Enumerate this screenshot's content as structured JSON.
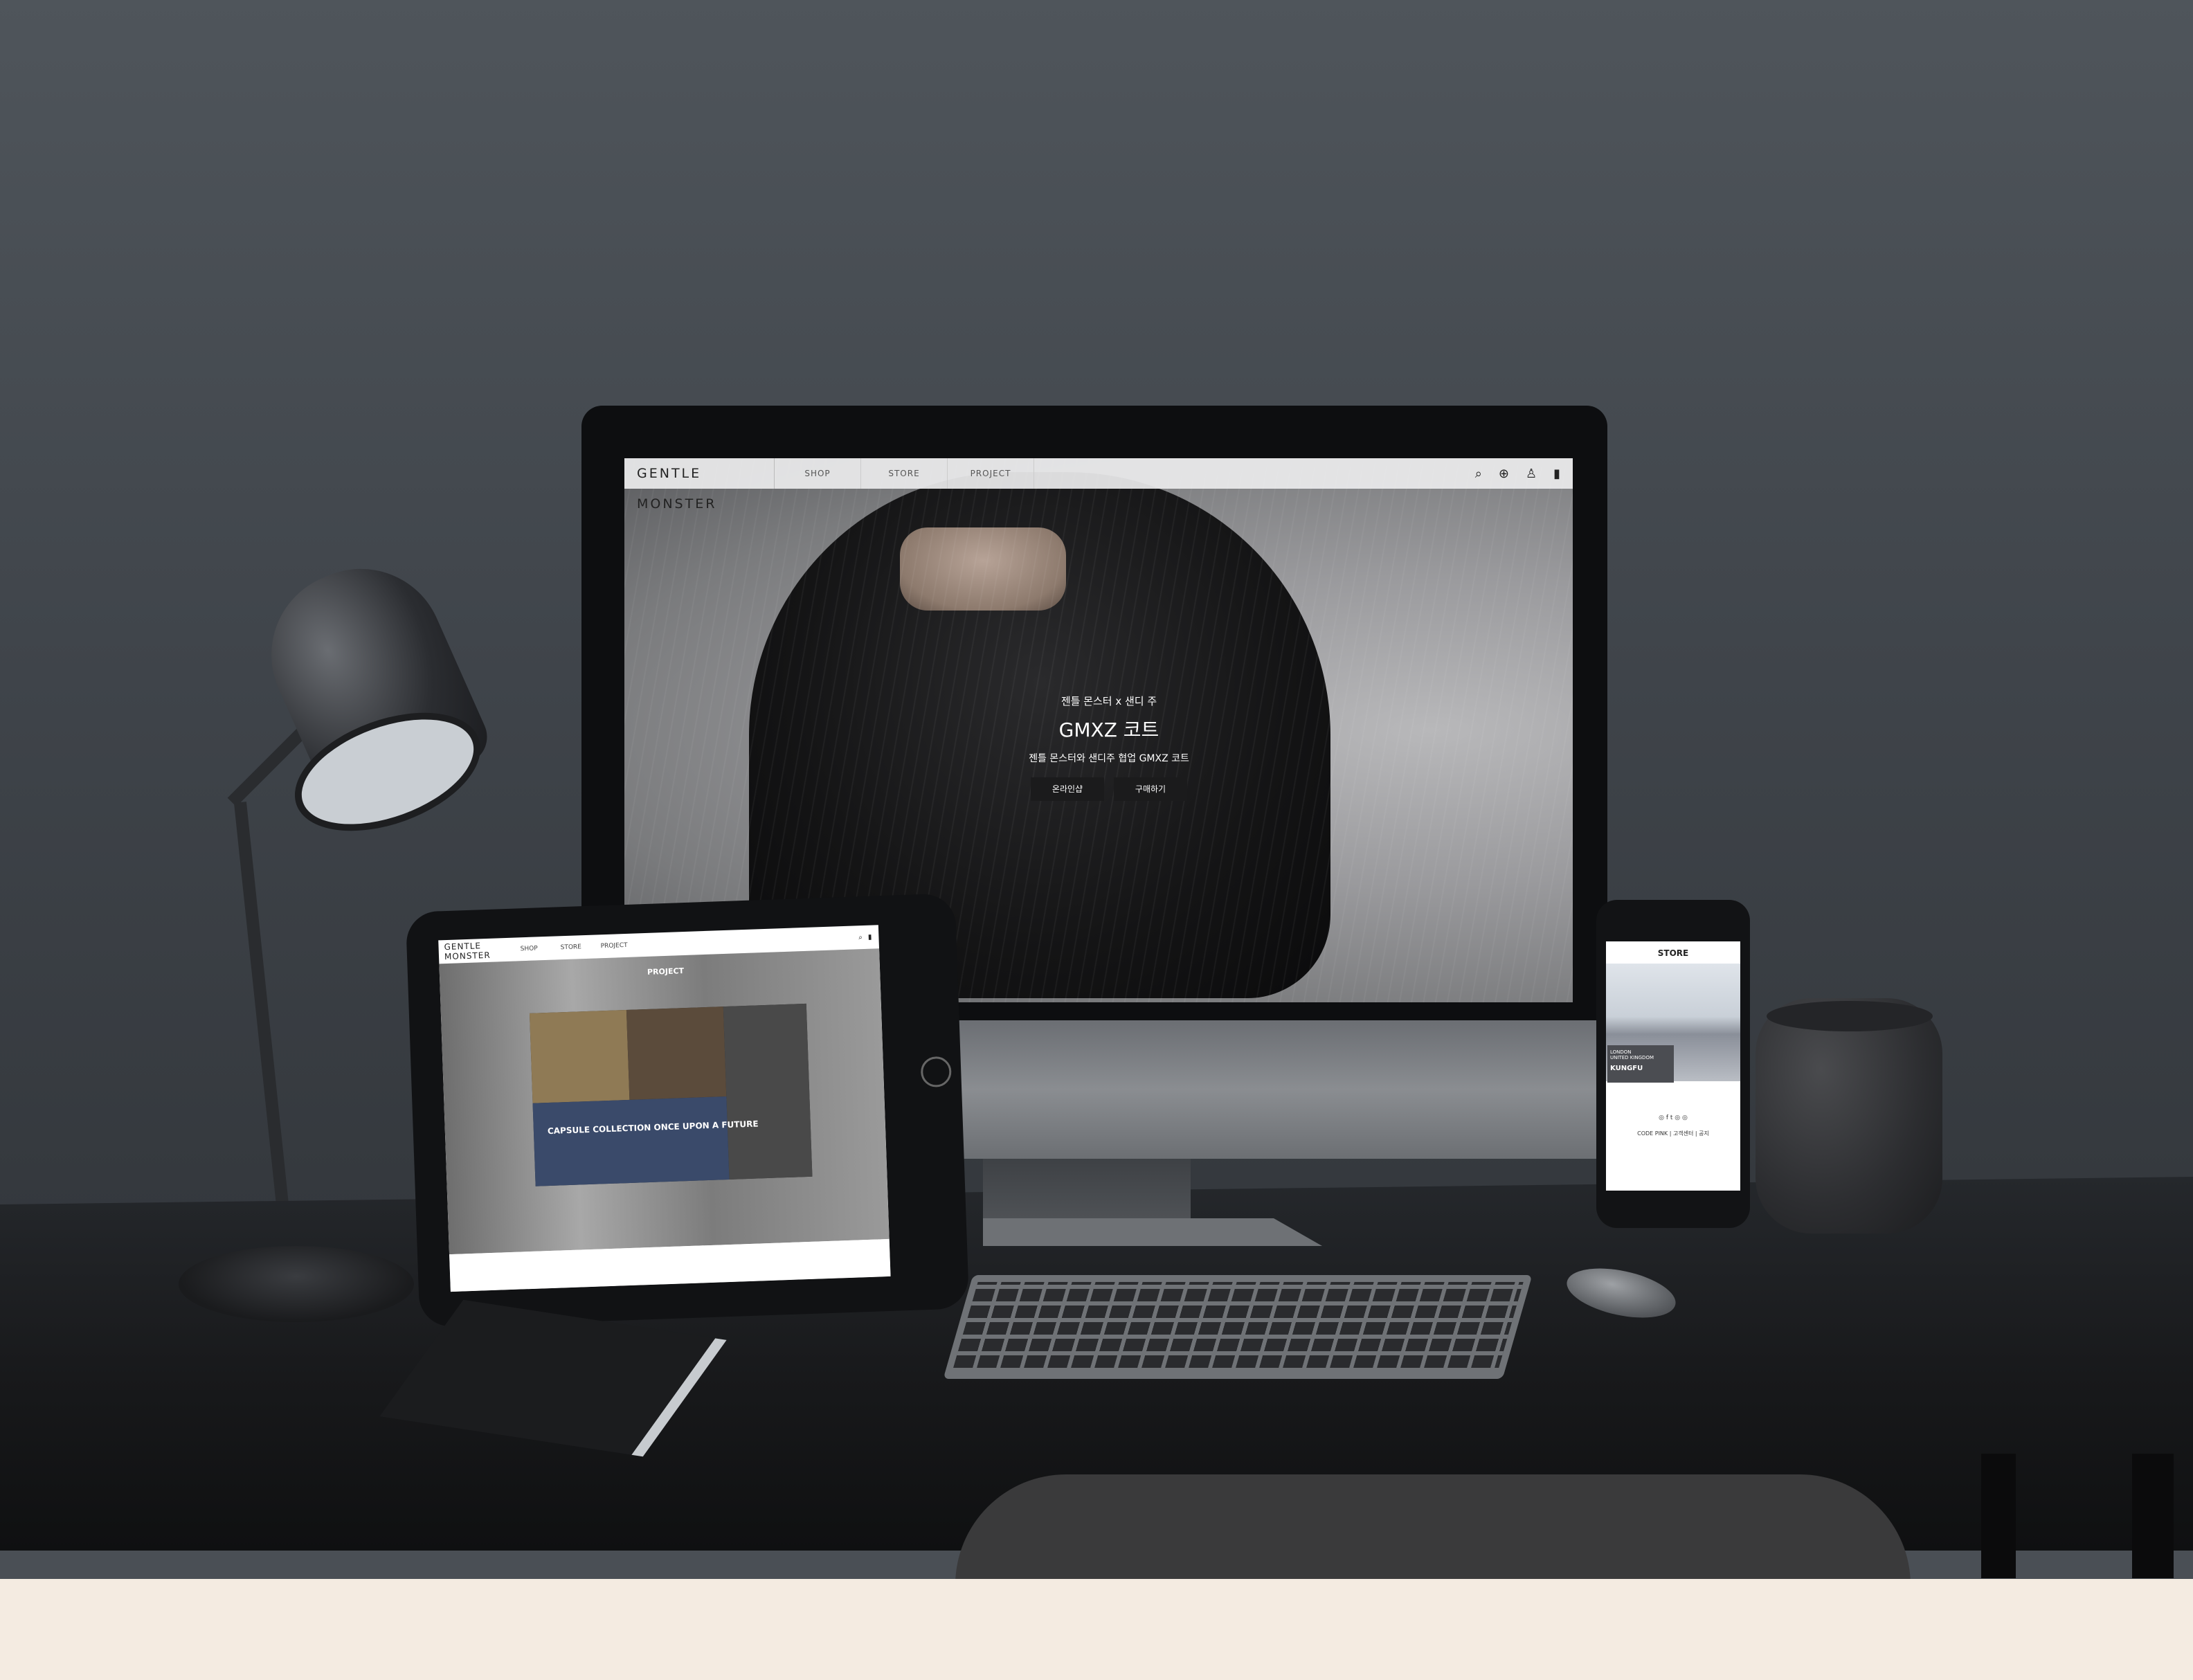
{
  "imac_site": {
    "logo": "GENTLE MONSTER",
    "nav": [
      "SHOP",
      "STORE",
      "PROJECT"
    ],
    "icons": [
      "search-icon",
      "globe-icon",
      "user-icon",
      "bag-icon"
    ],
    "hero": {
      "subtitle": "젠틀 몬스터 x 샌디 주",
      "title": "GMXZ 코트",
      "description": "젠틀 몬스터와 샌디주 협업 GMXZ 코트",
      "buttons": [
        "온라인샵",
        "구매하기"
      ]
    }
  },
  "ipad_site": {
    "logo": "GENTLE MONSTER",
    "nav": [
      "SHOP",
      "STORE",
      "PROJECT"
    ],
    "section_title": "PROJECT",
    "caption": "CAPSULE COLLECTION ONCE UPON A FUTURE"
  },
  "phone_site": {
    "title": "STORE",
    "tag_line1": "LONDON",
    "tag_line2": "UNITED KINGDOM",
    "tag_name": "KUNGFU",
    "social_line": "◎  f  t  ◎  ◎",
    "links": "CODE PINK  |  고객센터  |  공지"
  },
  "colors": {
    "wall": "#4a4f55",
    "floor_band": "#f4ebe1",
    "desk": "#18191b"
  }
}
